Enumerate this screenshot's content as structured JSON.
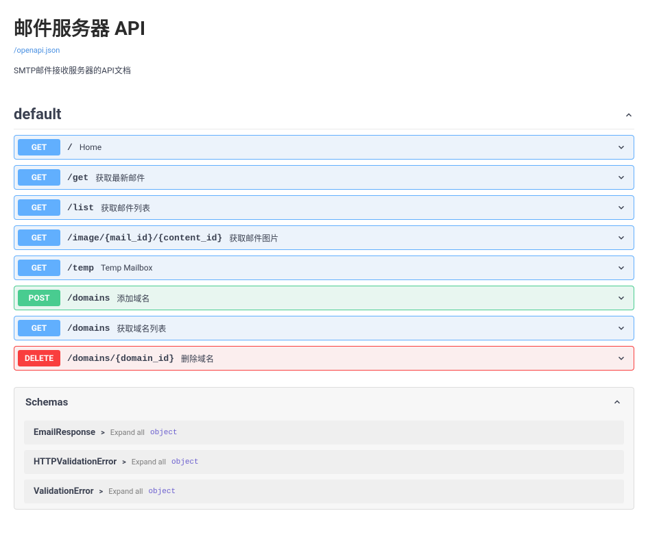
{
  "header": {
    "title": "邮件服务器 API",
    "spec_link": "/openapi.json",
    "description": "SMTP邮件接收服务器的API文档"
  },
  "tag": {
    "name": "default"
  },
  "operations": [
    {
      "method": "GET",
      "path": "/",
      "summary": "Home"
    },
    {
      "method": "GET",
      "path": "/get",
      "summary": "获取最新邮件"
    },
    {
      "method": "GET",
      "path": "/list",
      "summary": "获取邮件列表"
    },
    {
      "method": "GET",
      "path": "/image/{mail_id}/{content_id}",
      "summary": "获取邮件图片"
    },
    {
      "method": "GET",
      "path": "/temp",
      "summary": "Temp Mailbox"
    },
    {
      "method": "POST",
      "path": "/domains",
      "summary": "添加域名"
    },
    {
      "method": "GET",
      "path": "/domains",
      "summary": "获取域名列表"
    },
    {
      "method": "DELETE",
      "path": "/domains/{domain_id}",
      "summary": "删除域名"
    }
  ],
  "schemas": {
    "title": "Schemas",
    "expand_all_label": "Expand all",
    "object_label": "object",
    "items": [
      {
        "name": "EmailResponse"
      },
      {
        "name": "HTTPValidationError"
      },
      {
        "name": "ValidationError"
      }
    ]
  }
}
